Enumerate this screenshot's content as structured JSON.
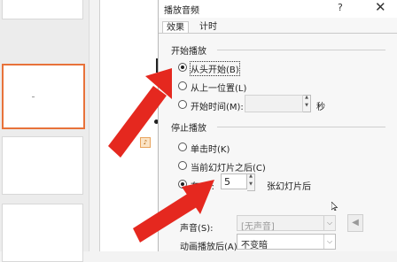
{
  "dialog": {
    "title": "播放音频",
    "help_glyph": "?",
    "close_glyph": "✕"
  },
  "tabs": [
    {
      "label": "效果"
    },
    {
      "label": "计时"
    }
  ],
  "start": {
    "group_label": "开始播放",
    "options": [
      {
        "label": "从头开始(B)",
        "selected": true
      },
      {
        "label": "从上一位置(L)",
        "selected": false
      },
      {
        "label": "开始时间(M):",
        "selected": false
      }
    ],
    "time_unit": "秒",
    "time_value": ""
  },
  "stop": {
    "group_label": "停止播放",
    "options": [
      {
        "label": "单击时(K)",
        "selected": false
      },
      {
        "label": "当前幻灯片之后(C)",
        "selected": false
      },
      {
        "label": "在(F):",
        "selected": true
      }
    ],
    "after_count": "5",
    "after_unit": "张幻灯片后"
  },
  "enhance": {
    "sound_label": "声音(S):",
    "sound_value": "[无声音]",
    "after_anim_label": "动画播放后(A):",
    "after_anim_value": "不变暗"
  },
  "slide_canvas": {
    "anim_tag": "♪"
  },
  "colors": {
    "arrow": "#e5281f",
    "thumb_selected_border": "#e8723a"
  }
}
